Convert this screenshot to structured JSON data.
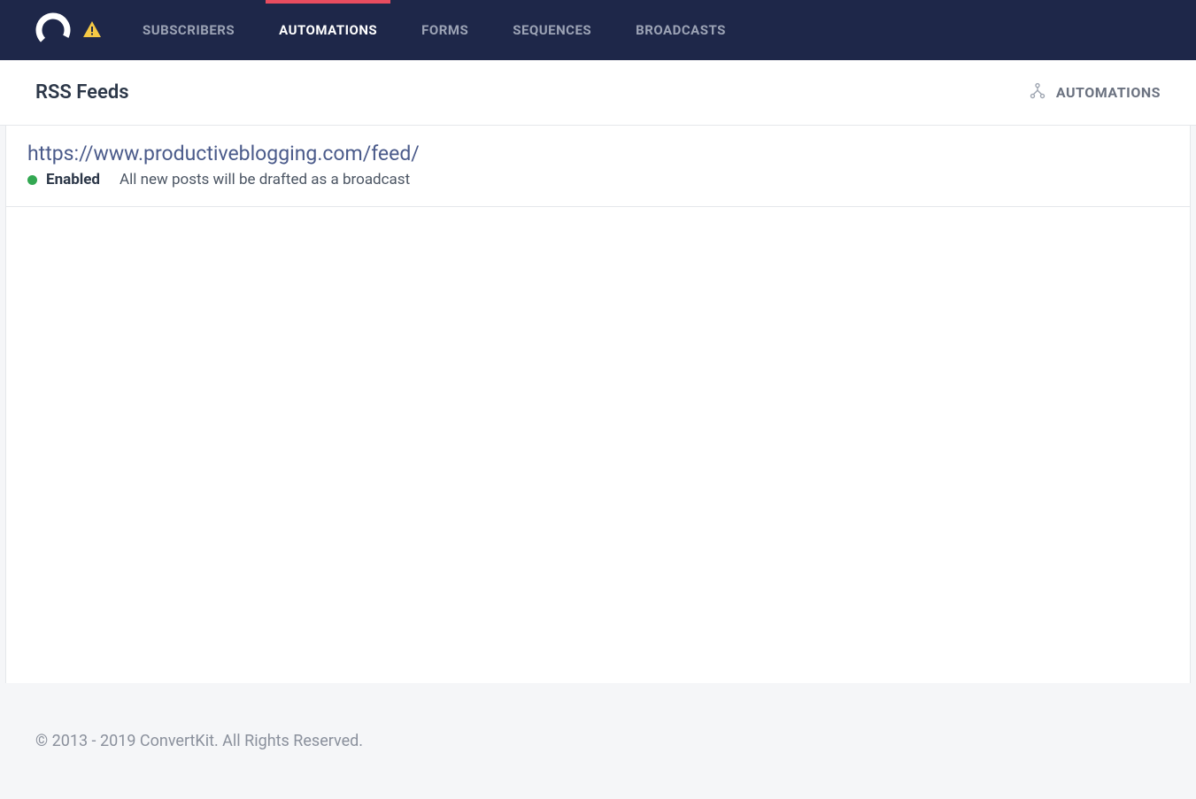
{
  "nav": {
    "items": [
      {
        "label": "SUBSCRIBERS",
        "active": false
      },
      {
        "label": "AUTOMATIONS",
        "active": true
      },
      {
        "label": "FORMS",
        "active": false
      },
      {
        "label": "SEQUENCES",
        "active": false
      },
      {
        "label": "BROADCASTS",
        "active": false
      }
    ]
  },
  "subheader": {
    "title": "RSS Feeds",
    "right_link": "AUTOMATIONS"
  },
  "feed": {
    "url": "https://www.productiveblogging.com/feed/",
    "status_label": "Enabled",
    "status_desc": "All new posts will be drafted as a broadcast",
    "status_color": "#33a852"
  },
  "footer": {
    "copyright": "© 2013 - 2019 ConvertKit. All Rights Reserved."
  }
}
